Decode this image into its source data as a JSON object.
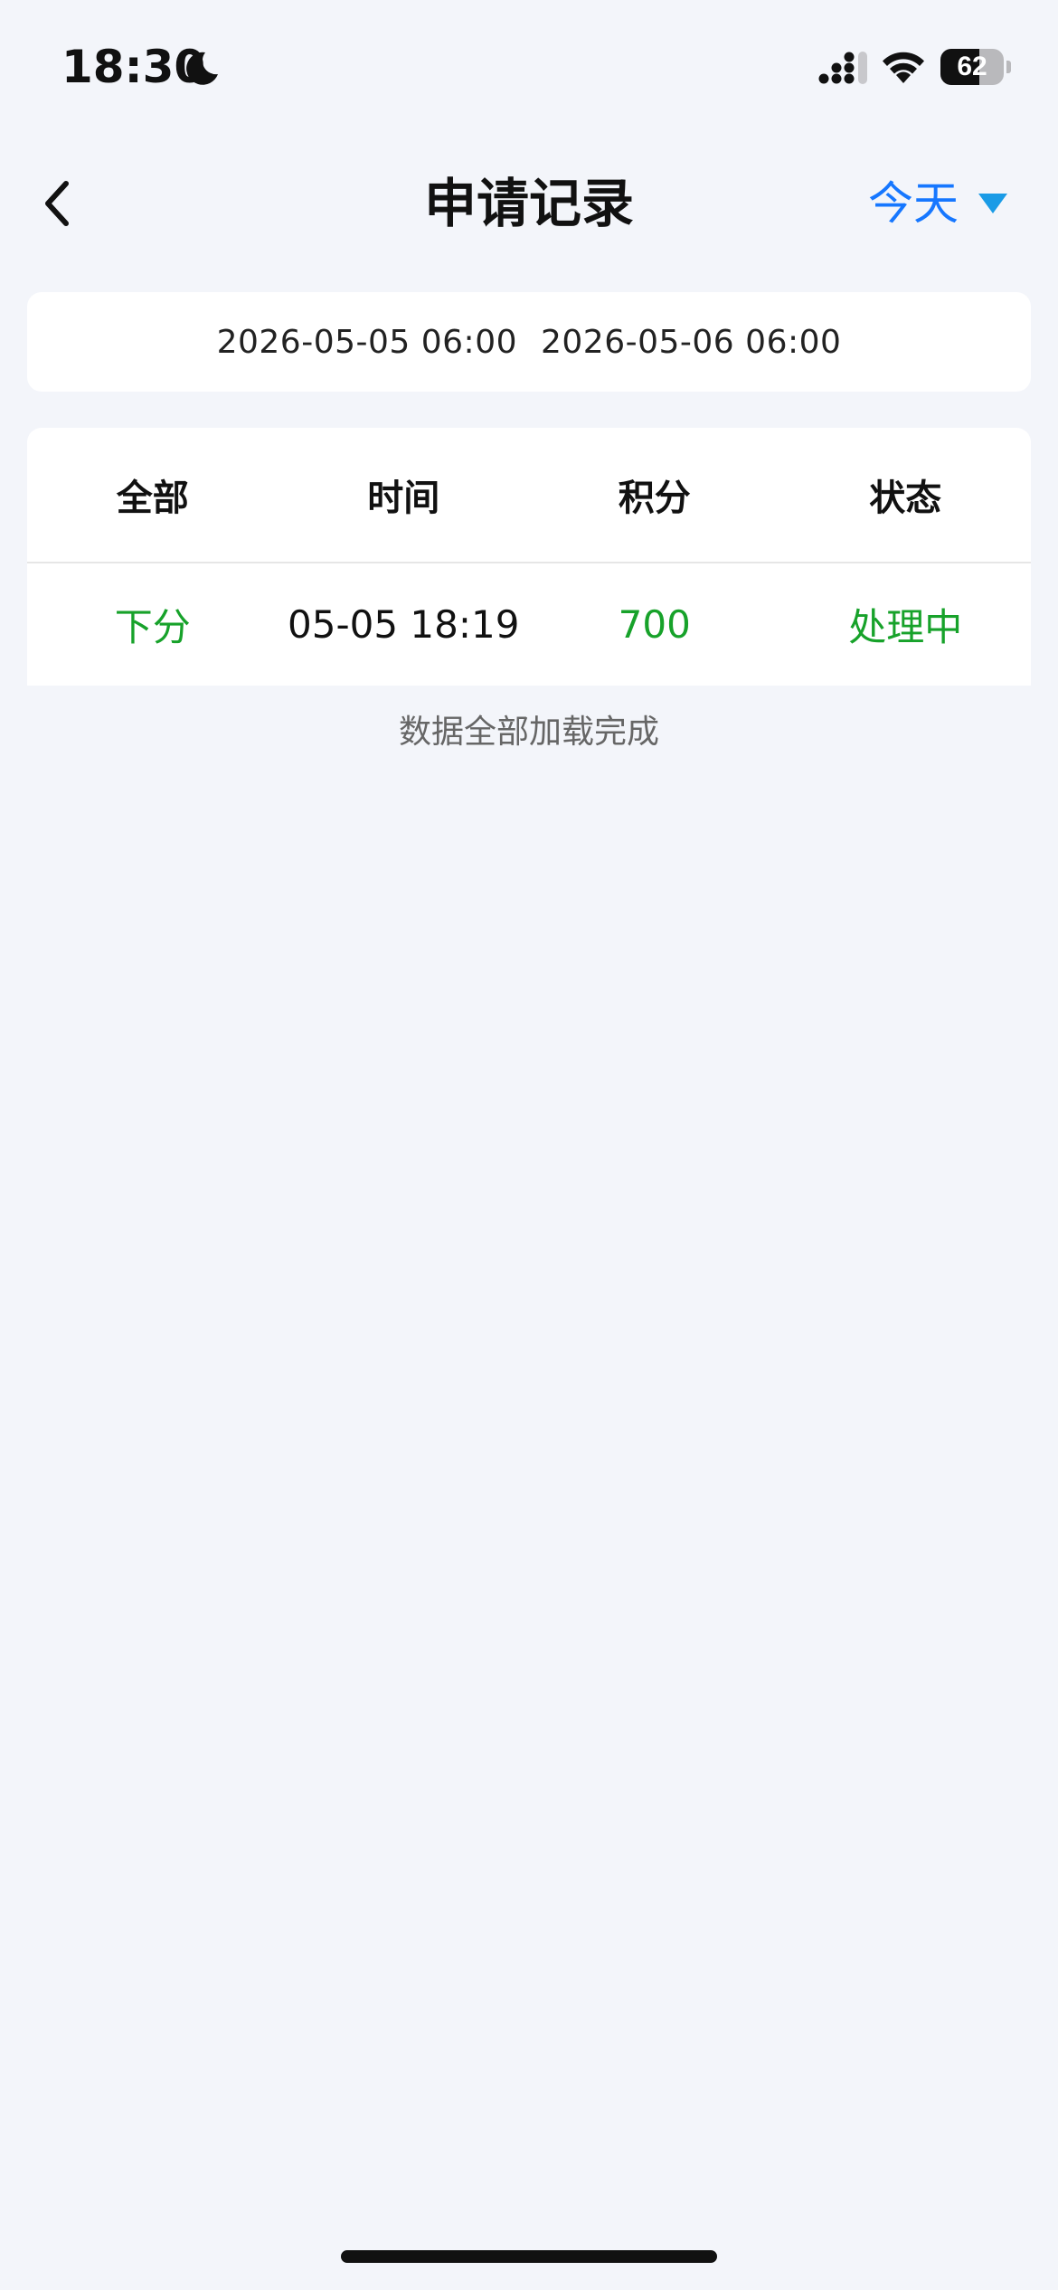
{
  "status_bar": {
    "time": "18:30",
    "battery_level": "62",
    "battery_fraction": 0.62
  },
  "nav": {
    "title": "申请记录",
    "filter_label": "今天",
    "accent_color": "#1677ff"
  },
  "date_range": {
    "start": "2026-05-05 06:00",
    "end": "2026-05-06 06:00"
  },
  "table": {
    "headers": [
      "全部",
      "时间",
      "积分",
      "状态"
    ],
    "rows": [
      {
        "type": "下分",
        "time": "05-05 18:19",
        "points": "700",
        "status": "处理中"
      }
    ],
    "status_color": "#17a22a"
  },
  "footer": {
    "load_complete_text": "数据全部加载完成"
  }
}
